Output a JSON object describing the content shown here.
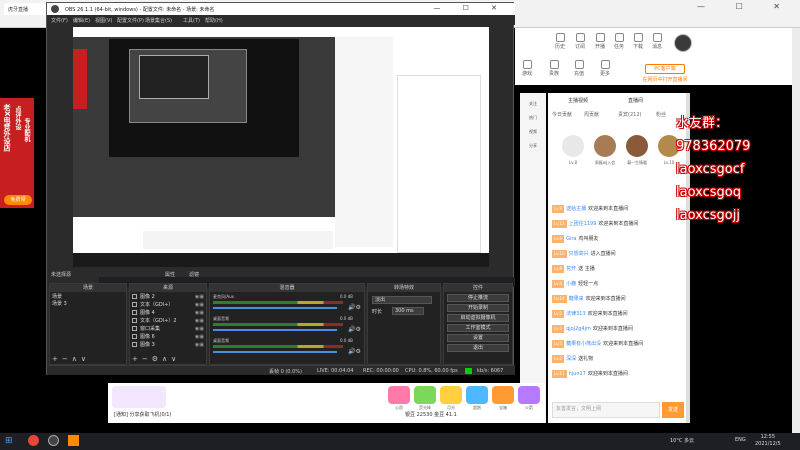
{
  "browser": {
    "tab": "虎牙直播",
    "controls": "— ☐ ✕"
  },
  "huya_nav": [
    {
      "label": "历史",
      "icon": "history-icon"
    },
    {
      "label": "订阅",
      "icon": "subscribe-icon"
    },
    {
      "label": "开播",
      "icon": "broadcast-icon"
    },
    {
      "label": "任务",
      "icon": "task-icon"
    },
    {
      "label": "下载",
      "icon": "download-icon"
    },
    {
      "label": "消息",
      "icon": "message-icon"
    },
    {
      "label": "更多",
      "icon": "more-icon"
    }
  ],
  "huya_nav2": [
    {
      "label": "游戏",
      "icon": "game-icon"
    },
    {
      "label": "贵族",
      "icon": "noble-icon"
    },
    {
      "label": "充值",
      "icon": "recharge-icon"
    },
    {
      "label": "更多",
      "icon": "more2-icon"
    }
  ],
  "pc_client": "PC客户端",
  "open_page": "在网页中打开直播间",
  "left_banner": {
    "col1": "老X电竞外设店",
    "col2": "点评外设",
    "col3": "专业配机",
    "live": "免费领"
  },
  "overlay": {
    "line1": "水友群：978362079",
    "line2": "laoxcsgocf",
    "line3": "laoxcsgoq",
    "line4": "laoxcsgojj"
  },
  "side_bar": [
    "关注",
    "热门",
    "视频",
    "分享"
  ],
  "chat": {
    "tabs": [
      "主播视频",
      "直播间"
    ],
    "subtabs": [
      "今日贡献",
      "周贡献",
      "贵宾(212)",
      "粉丝"
    ],
    "rank": [
      {
        "name": "Lv.8"
      },
      {
        "name": "周磊wJ入会"
      },
      {
        "name": "凝一生情暖"
      },
      {
        "name": "Lv.10"
      }
    ],
    "lines": [
      {
        "lv": "Lv.9",
        "name": "送给主播",
        "text": "欢迎来到本直播间"
      },
      {
        "lv": "Lv.12",
        "name": "上团住1199",
        "text": "欢迎来到本直播间"
      },
      {
        "lv": "Lv.6",
        "name": "Gira",
        "text": "鸡叫朋友"
      },
      {
        "lv": "Lv.10",
        "name": "只想高兴",
        "text": "进入直播间"
      },
      {
        "lv": "Lv.8",
        "name": "花开",
        "text": "送 主播"
      },
      {
        "lv": "Lv.4",
        "name": "小鹿",
        "text": "轻轻一点"
      },
      {
        "lv": "Lv.14",
        "name": "糖果来",
        "text": "欢迎来到本直播间"
      },
      {
        "lv": "Lv.2",
        "name": "法律313",
        "text": "欢迎来到本直播间"
      },
      {
        "lv": "Lv.3",
        "name": "qjoj2g4jm",
        "text": "欢迎来到本直播间"
      },
      {
        "lv": "Lv.5",
        "name": "糖果有小熊出没",
        "text": "欢迎来到本直播间"
      },
      {
        "lv": "Lv.2",
        "name": "深深",
        "text": "送礼物"
      },
      {
        "lv": "Lv.11",
        "name": "hjun17",
        "text": "欢迎来到本直播间"
      }
    ],
    "input_placeholder": "友善发言，文明上网",
    "send": "发送"
  },
  "gift_bar": {
    "gifts": [
      {
        "label": "心愿",
        "color": "#ff7aa8"
      },
      {
        "label": "荧光棒",
        "color": "#7bd85a"
      },
      {
        "label": "月光",
        "color": "#ffcf3f"
      },
      {
        "label": "超跑",
        "color": "#4db7ff"
      },
      {
        "label": "宝箱",
        "color": "#ff9b32"
      },
      {
        "label": "火箭",
        "color": "#b57aff"
      }
    ],
    "note": "[通知] 分享获取飞机(0/1)",
    "coins": "银豆 22530   金豆 41.1"
  },
  "taskbar": {
    "weather": "10°C 多云",
    "lang": "ENG",
    "time": "12:55",
    "date": "2021/12/5"
  },
  "obs": {
    "title": "OBS 26.1.1 (64-bit, windows) - 配置文件: 未命名 - 场景: 未命名",
    "controls": "— ☐ ✕",
    "menu": [
      "文件(F)",
      "编辑(E)",
      "视图(V)",
      "配置文件(P)",
      "场景集合(S)",
      "工具(T)",
      "帮助(H)"
    ],
    "status_label": "未选择源",
    "attr1": "属性",
    "attr2": "滤镜",
    "scenes": {
      "header": "场景",
      "items": [
        "场景",
        "场景 3"
      ]
    },
    "sources": {
      "header": "来源",
      "items": [
        "图像 2",
        "文本（GDI+）",
        "图像 4",
        "文本（GDI+）2",
        "窗口采集",
        "图像 6",
        "图像 3"
      ]
    },
    "mixer": {
      "header": "混音器",
      "tracks": [
        {
          "name": "麦克风/Aux",
          "db": "0.0 dB"
        },
        {
          "name": "桌面音频",
          "db": "0.0 dB"
        },
        {
          "name": "桌面音频",
          "db": "0.0 dB"
        }
      ]
    },
    "transitions": {
      "header": "转场特效",
      "type": "淡出",
      "duration_label": "时长",
      "duration": "300 ms"
    },
    "controls_dock": {
      "header": "控件",
      "buttons": [
        "停止推流",
        "开始录制",
        "启动虚拟摄像机",
        "工作室模式",
        "设置",
        "退出"
      ]
    },
    "statusbar": {
      "dropped": "丢帧 0 (0.0%)",
      "live": "LIVE: 00:04:04",
      "rec": "REC: 00:00:00",
      "cpu": "CPU: 0.8%, 60.00 fps",
      "kbps": "kb/s: 6067"
    }
  }
}
